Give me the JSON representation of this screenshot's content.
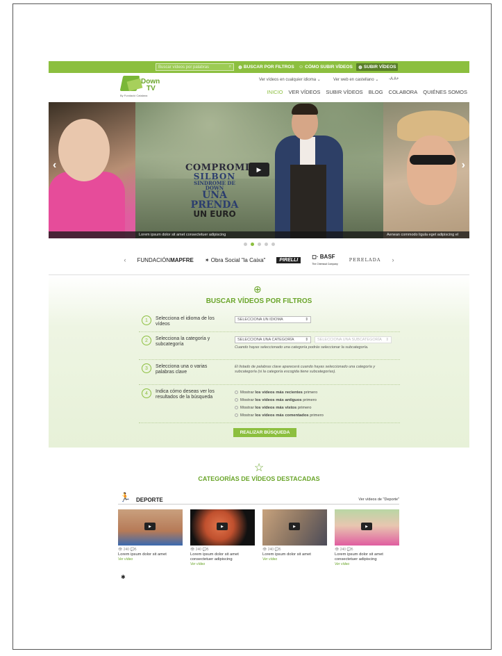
{
  "topbar": {
    "search_placeholder": "Buscar vídeos por palabras",
    "search_icon": "search-icon",
    "filter_label": "BUSCAR POR FILTROS",
    "howto_label": "CÓMO SUBIR VÍDEOS",
    "upload_label": "SUBIR VÍDEOS"
  },
  "header": {
    "logo_down": "Down",
    "logo_tv": "TV",
    "logo_by": "By Fundació Catalana",
    "video_lang": "Ver vídeos en cualquier idioma",
    "web_lang": "Ver web en castellano",
    "font_size": "-A A+",
    "nav": [
      "INICIO",
      "VER VÍDEOS",
      "SUBIR VÍDEOS",
      "BLOG",
      "COLABORA",
      "QUIÉNES SOMOS"
    ]
  },
  "slider": {
    "title_l1": "COMPROMISO",
    "title_l2": "SILBON",
    "title_l3": "SINDROME DE DOWN",
    "title_l4": "UNA PRENDA",
    "title_l5": "UN EURO",
    "caption_main": "Lorem ipsum dolor sit amet consectetuer adipiscing",
    "caption_right": "Aenean commodo ligula eget adipiscing el",
    "dots": 5,
    "active_dot": 1
  },
  "sponsors": {
    "mapfre_a": "FUNDACIÓN",
    "mapfre_b": "MAPFRE",
    "lacaixa": "Obra Social \"la Caixa\"",
    "pirelli": "PIRELLI",
    "basf": "BASF",
    "basf_sub": "The Chemical Company",
    "perelada": "PERELADA"
  },
  "filters": {
    "title": "BUSCAR VÍDEOS POR FILTROS",
    "step1_num": "1",
    "step1_label": "Selecciona el idioma de los vídeos",
    "step1_select": "SELECCIONA UN IDIOMA",
    "step2_num": "2",
    "step2_label": "Selecciona la categoría y subcategoría",
    "step2_select_a": "SELECCIONA UNA CATEGORÍA",
    "step2_select_b": "SELECCIONA UNA SUBCATEGORÍA",
    "step2_hint": "Cuando hayas seleccionado una categoría podrás seleccionar la subcategoría.",
    "step3_num": "3",
    "step3_label": "Selecciona una o varias palabras clave",
    "step3_hint": "El listado de palabras clave aparecerá cuando hayas seleccionado una categoría y subcategoría (si la categoría escogida tiene subcategorías).",
    "step4_num": "4",
    "step4_label": "Indica cómo deseas ver los resultados de la búsqueda",
    "options": [
      {
        "pre": "Mostrar ",
        "bold": "los vídeos más recientes",
        "post": " primero"
      },
      {
        "pre": "Mostrar ",
        "bold": "los vídeos más antiguos",
        "post": " primero"
      },
      {
        "pre": "Mostrar ",
        "bold": "los vídeos más vistos",
        "post": " primero"
      },
      {
        "pre": "Mostrar ",
        "bold": "los vídeos más comentados",
        "post": " primero"
      }
    ],
    "submit": "REALIZAR BÚSQUEDA"
  },
  "categories": {
    "title": "CATEGORÍAS DE VÍDEOS DESTACADAS",
    "deporte": "DEPORTE",
    "more": "Ver vídeos de \"Deporte\"",
    "cards": [
      {
        "views": "240",
        "comments": "5",
        "text": "Lorem ipsum dolor sit amet",
        "link": "Ver vídeo"
      },
      {
        "views": "240",
        "comments": "5",
        "text": "Lorem ipsum dolor sit amet consectetuer adipiscing",
        "link": "Ver vídeo"
      },
      {
        "views": "240",
        "comments": "5",
        "text": "Lorem ipsum dolor sit amet",
        "link": "Ver vídeo"
      },
      {
        "views": "240",
        "comments": "5",
        "text": "Lorem ipsum dolor sit amet consectetuer adipiscing",
        "link": "Ver vídeo"
      }
    ]
  },
  "colors": {
    "brand_green": "#8cbf3f",
    "dark_green": "#6aa52a"
  }
}
